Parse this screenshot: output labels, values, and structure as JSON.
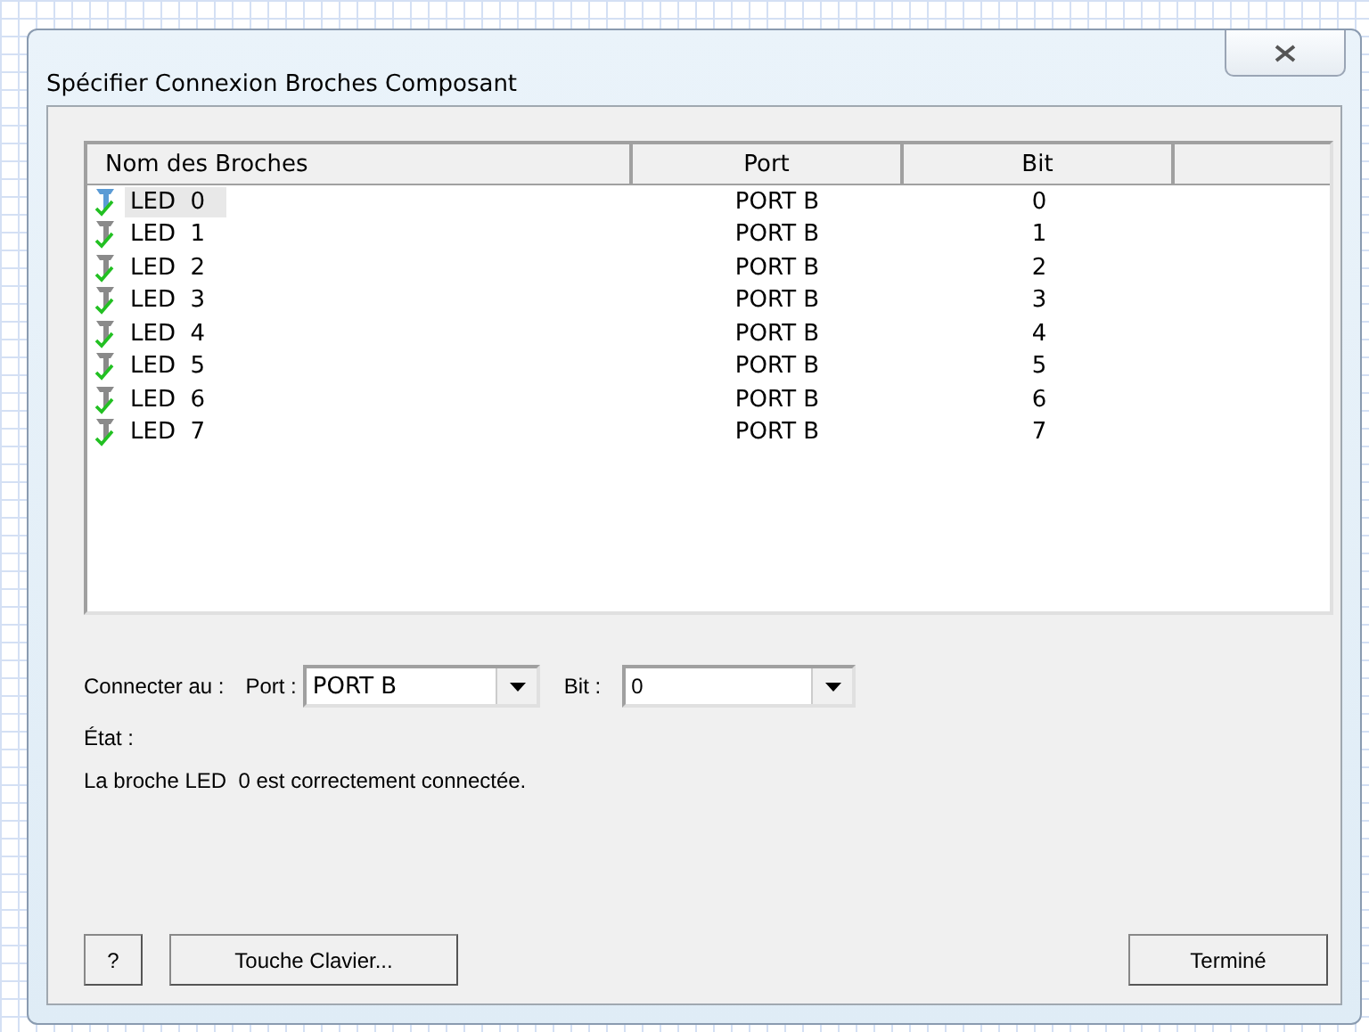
{
  "window": {
    "title": "Spécifier Connexion Broches Composant"
  },
  "table": {
    "columns": [
      "Nom des Broches",
      "Port",
      "Bit"
    ],
    "rows": [
      {
        "name": "LED  0",
        "port": "PORT B",
        "bit": "0",
        "selected": true
      },
      {
        "name": "LED  1",
        "port": "PORT B",
        "bit": "1",
        "selected": false
      },
      {
        "name": "LED  2",
        "port": "PORT B",
        "bit": "2",
        "selected": false
      },
      {
        "name": "LED  3",
        "port": "PORT B",
        "bit": "3",
        "selected": false
      },
      {
        "name": "LED  4",
        "port": "PORT B",
        "bit": "4",
        "selected": false
      },
      {
        "name": "LED  5",
        "port": "PORT B",
        "bit": "5",
        "selected": false
      },
      {
        "name": "LED  6",
        "port": "PORT B",
        "bit": "6",
        "selected": false
      },
      {
        "name": "LED  7",
        "port": "PORT B",
        "bit": "7",
        "selected": false
      }
    ]
  },
  "connect": {
    "label": "Connecter au :",
    "port_label": "Port :",
    "port_value": "PORT B",
    "bit_label": "Bit :",
    "bit_value": "0"
  },
  "status": {
    "label": "État :",
    "message": "La broche LED  0 est correctement connectée."
  },
  "buttons": {
    "help": "?",
    "keyboard": "Touche Clavier...",
    "done": "Terminé"
  }
}
